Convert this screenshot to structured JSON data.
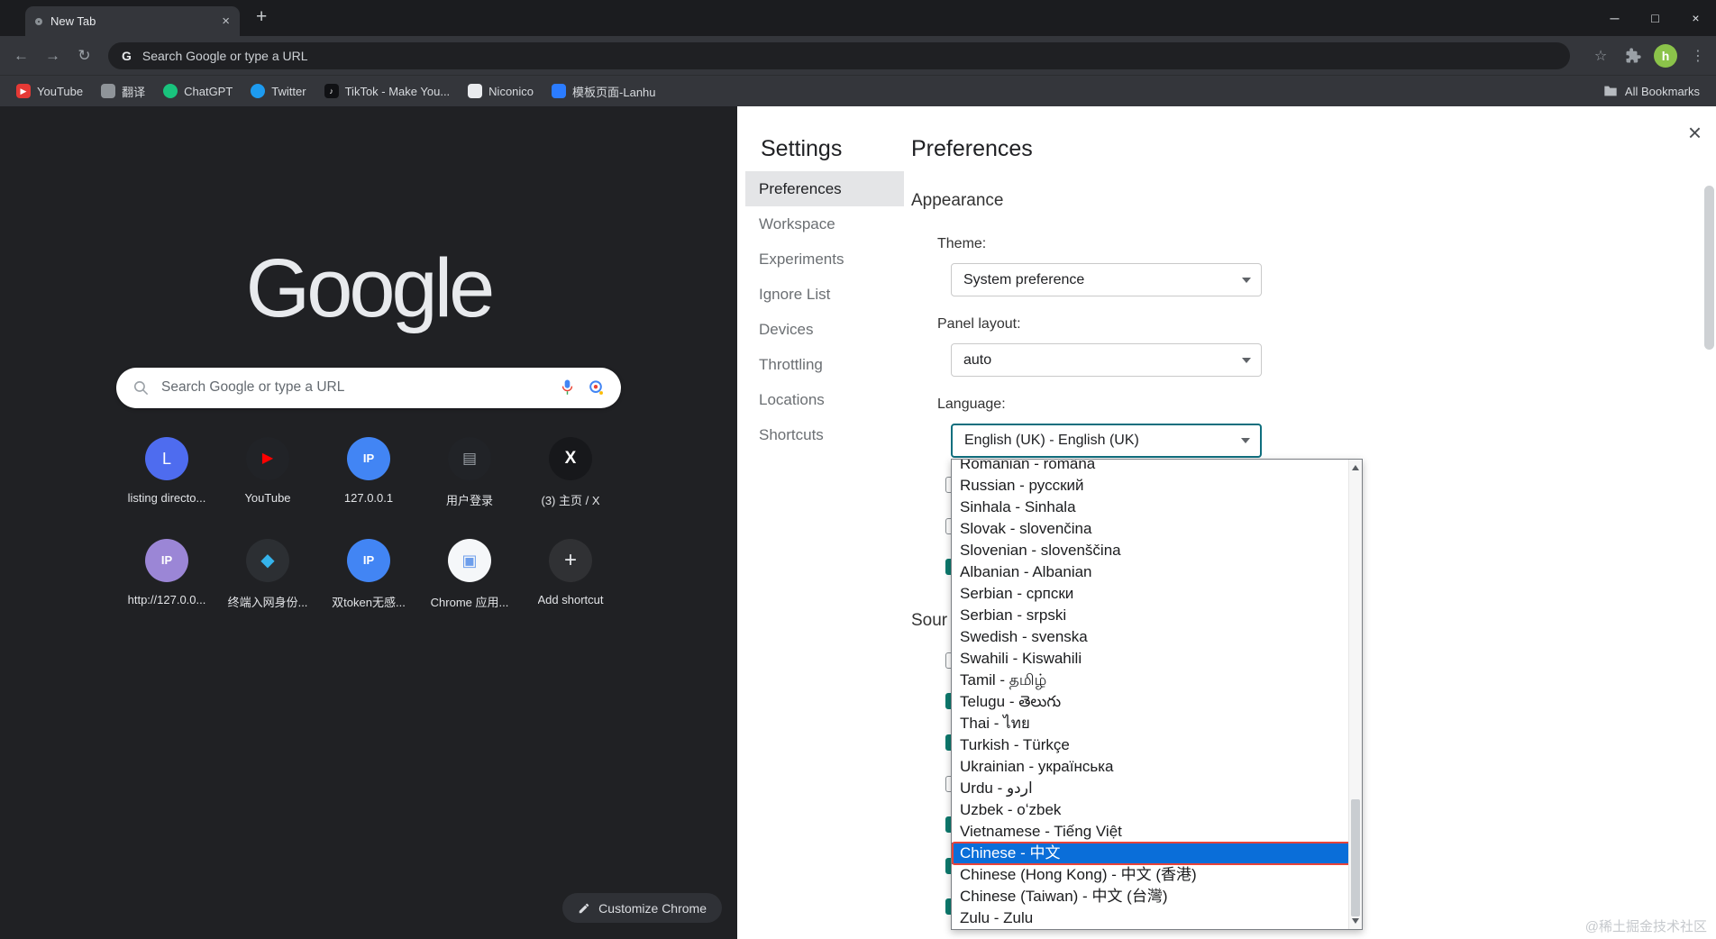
{
  "colors": {
    "selection_blue": "#0a6ed9",
    "marker_red": "#e8443a",
    "focus_teal": "#0f6f7e",
    "checkbox_teal": "#0e7a6e",
    "accent_blue": "#4285f4"
  },
  "browser": {
    "tab_title": "New Tab",
    "omnibox_text": "Search Google or type a URL",
    "avatar_letter": "h",
    "all_bookmarks_label": "All Bookmarks",
    "bookmarks": [
      {
        "label": "YouTube",
        "color": "#e53935",
        "glyph": "▶",
        "glyph_color": "#ffffff",
        "round": false
      },
      {
        "label": "翻译",
        "color": "#8f9499",
        "glyph": "",
        "round": false
      },
      {
        "label": "ChatGPT",
        "color": "#19c37d",
        "glyph": "",
        "round": true
      },
      {
        "label": "Twitter",
        "color": "#1d9bf0",
        "glyph": "",
        "round": true
      },
      {
        "label": "TikTok - Make You...",
        "color": "#101114",
        "glyph": "♪",
        "glyph_color": "#ffffff",
        "round": false
      },
      {
        "label": "Niconico",
        "color": "#e9ebee",
        "glyph": "",
        "round": false
      },
      {
        "label": "模板页面-Lanhu",
        "color": "#2b7cff",
        "glyph": "",
        "round": false
      }
    ]
  },
  "ntp": {
    "logo_text": "Google",
    "search_placeholder": "Search Google or type a URL",
    "customize_button": "Customize Chrome",
    "shortcuts": [
      {
        "label": "listing directo...",
        "bg": "#4e6cef",
        "glyph": "L",
        "glyph_color": "#ffffff",
        "glyph_size": "18px",
        "bold": false
      },
      {
        "label": "YouTube",
        "bg": "#212327",
        "glyph": "▶",
        "glyph_color": "#ff0000",
        "glyph_size": "16px",
        "bold": false
      },
      {
        "label": "127.0.0.1",
        "bg": "#4285f4",
        "glyph": "IP",
        "glyph_color": "#ffffff",
        "glyph_size": "13px",
        "bold": true
      },
      {
        "label": "用户登录",
        "bg": "#212327",
        "glyph": "▤",
        "glyph_color": "#9aa0a6",
        "glyph_size": "17px",
        "bold": false
      },
      {
        "label": "(3) 主页 / X",
        "bg": "#17181b",
        "glyph": "X",
        "glyph_color": "#ffffff",
        "glyph_size": "19px",
        "bold": true
      },
      {
        "label": "http://127.0.0...",
        "bg": "#9b86d6",
        "glyph": "IP",
        "glyph_color": "#ffffff",
        "glyph_size": "13px",
        "bold": true
      },
      {
        "label": "终端入网身份...",
        "bg": "#2c2f33",
        "glyph": "◆",
        "glyph_color": "#35b3eb",
        "glyph_size": "20px",
        "bold": false
      },
      {
        "label": "双token无感...",
        "bg": "#4285f4",
        "glyph": "IP",
        "glyph_color": "#ffffff",
        "glyph_size": "13px",
        "bold": true
      },
      {
        "label": "Chrome 应用...",
        "bg": "#f5f7f9",
        "glyph": "▣",
        "glyph_color": "#6d9eeb",
        "glyph_size": "18px",
        "bold": false
      },
      {
        "label": "Add shortcut",
        "bg": "#303134",
        "glyph": "+",
        "glyph_color": "#e8eaed",
        "glyph_size": "24px",
        "bold": false
      }
    ]
  },
  "devtools": {
    "settings_title": "Settings",
    "panel_title": "Preferences",
    "appearance_heading": "Appearance",
    "partial_text": "Sour",
    "sidebar": {
      "selected_index": 0,
      "items": [
        "Preferences",
        "Workspace",
        "Experiments",
        "Ignore List",
        "Devices",
        "Throttling",
        "Locations",
        "Shortcuts"
      ]
    },
    "fields": {
      "theme": {
        "label": "Theme:",
        "value": "System preference"
      },
      "panel_layout": {
        "label": "Panel layout:",
        "value": "auto"
      },
      "language": {
        "label": "Language:",
        "value": "English (UK) - English (UK)"
      }
    },
    "language_dropdown": {
      "selected_index": 18,
      "selected": "Chinese - 中文",
      "options": [
        "Romanian - română",
        "Russian - русский",
        "Sinhala - Sinhala",
        "Slovak - slovenčina",
        "Slovenian - slovenščina",
        "Albanian - Albanian",
        "Serbian - српски",
        "Serbian - srpski",
        "Swedish - svenska",
        "Swahili - Kiswahili",
        "Tamil - தமிழ்",
        "Telugu - తెలుగు",
        "Thai - ไทย",
        "Turkish - Türkçe",
        "Ukrainian - українська",
        "Urdu - اردو",
        "Uzbek - oʻzbek",
        "Vietnamese - Tiếng Việt",
        "Chinese - 中文",
        "Chinese (Hong Kong) - 中文 (香港)",
        "Chinese (Taiwan) - 中文 (台灣)",
        "Zulu - Zulu"
      ]
    },
    "hidden_checkboxes": [
      false,
      false,
      true,
      false,
      true,
      true,
      false,
      true,
      true,
      true
    ]
  },
  "watermark": "@稀土掘金技术社区"
}
